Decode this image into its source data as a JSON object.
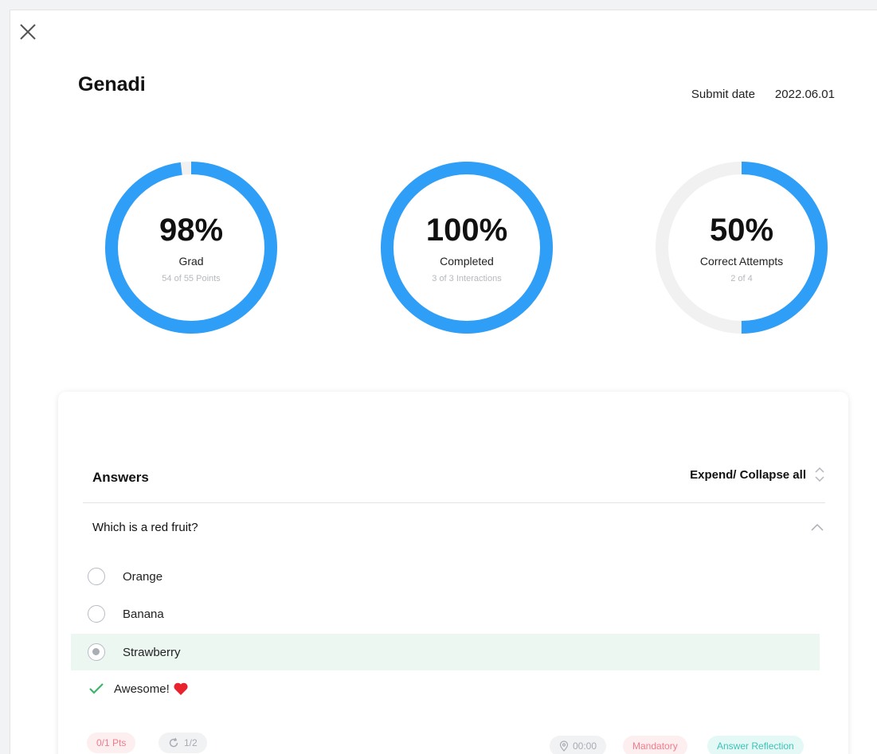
{
  "header": {
    "student_name": "Genadi",
    "submit_label": "Submit date",
    "submit_date": "2022.06.01"
  },
  "stats": [
    {
      "value": "98%",
      "label": "Grad",
      "sub": "54 of 55 Points",
      "fraction": 0.98
    },
    {
      "value": "100%",
      "label": "Completed",
      "sub": "3 of 3 Interactions",
      "fraction": 1.0
    },
    {
      "value": "50%",
      "label": "Correct Attempts",
      "sub": "2 of 4",
      "fraction": 0.5
    }
  ],
  "answers": {
    "title": "Answers",
    "expand_label": "Expend/ Collapse all",
    "question": "Which is a red fruit?",
    "options": [
      {
        "label": "Orange",
        "selected": false
      },
      {
        "label": "Banana",
        "selected": false
      },
      {
        "label": "Strawberry",
        "selected": true
      }
    ],
    "feedback": "Awesome!",
    "chips": {
      "points": "0/1 Pts",
      "attempts": "1/2",
      "time": "00:00",
      "mandatory": "Mandatory",
      "reflection": "Answer Reflection"
    }
  },
  "colors": {
    "accent": "#2f9ef7",
    "ring_track": "#f1f1f2",
    "selected_row": "#edf7f2",
    "success": "#3cb46a",
    "heart": "#e8232e"
  },
  "icons": {
    "close": "close-icon",
    "expand": "chevron-up-down-icon",
    "collapse": "chevron-up-icon",
    "check": "check-icon",
    "heart": "heart-icon",
    "retry": "retry-icon",
    "location": "location-pin-icon"
  }
}
